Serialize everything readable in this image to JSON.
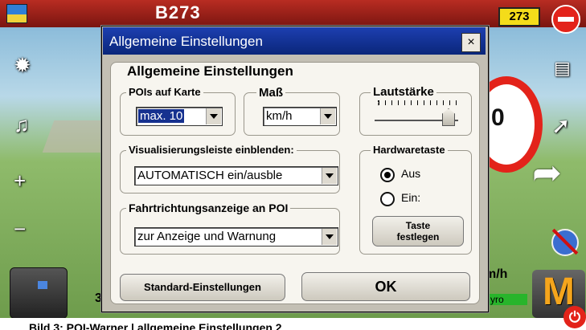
{
  "background": {
    "road_name": "B273",
    "route_number": "273",
    "speed_sign_partial": "0",
    "speed_unit_partial": "m/h",
    "status_partial": "yro",
    "distance_partial": "3(",
    "menu_button_letter": "M",
    "power_symbol": "⏻",
    "left_icons": [
      "map-mode-icon",
      "brightness-icon",
      "music-note-icon",
      "zoom-in-icon",
      "zoom-out-icon",
      "route-button-icon"
    ],
    "right_icons": [
      "no-entry-icon",
      "battery-icon",
      "navigation-arrow-icon",
      "turn-arrow-icon",
      "bluetooth-off-icon",
      "menu-icon",
      "power-icon"
    ]
  },
  "dialog": {
    "title": "Allgemeine Einstellungen",
    "close_label": "×",
    "panel_title": "Allgemeine Einstellungen",
    "pois": {
      "title": "POIs auf Karte",
      "value": "max. 10"
    },
    "mass": {
      "title": "Maß",
      "value": "km/h"
    },
    "volume": {
      "title": "Lautstärke",
      "level_percent": 95
    },
    "vis_bar": {
      "title": "Visualisierungsleiste einblenden:",
      "value": "AUTOMATISCH ein/ausble"
    },
    "direction": {
      "title": "Fahrtrichtungsanzeige an POI",
      "value": "zur Anzeige und Warnung"
    },
    "hardware": {
      "title": "Hardwaretaste",
      "options": [
        {
          "label": "Aus",
          "selected": true
        },
        {
          "label": "Ein:",
          "selected": false
        }
      ],
      "assign_button": "Taste festlegen"
    },
    "defaults_button": "Standard-Einstellungen",
    "ok_button": "OK"
  },
  "caption": "Bild 3: POI-Warner | allgemeine Einstellungen 2"
}
